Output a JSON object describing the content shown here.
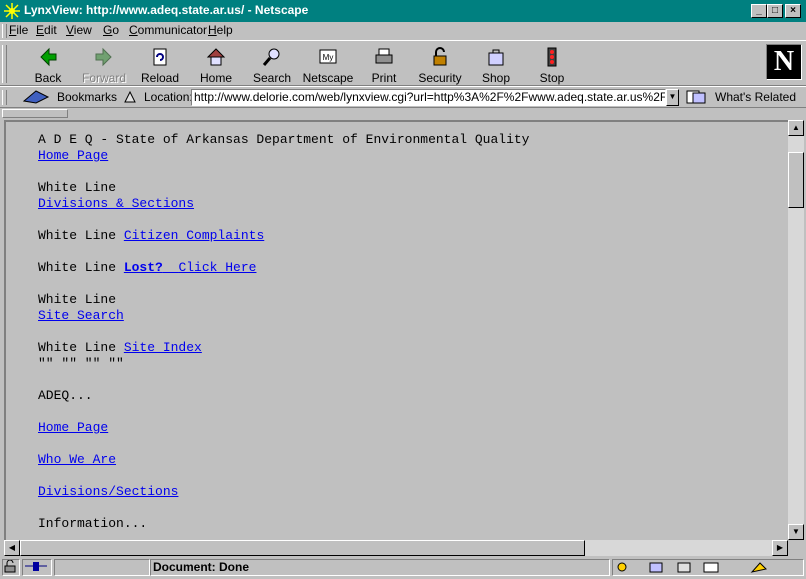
{
  "window": {
    "title": "LynxView: http://www.adeq.state.ar.us/ - Netscape"
  },
  "menu": [
    {
      "label": "File",
      "key": "F",
      "rest": "ile"
    },
    {
      "label": "Edit",
      "key": "E",
      "rest": "dit"
    },
    {
      "label": "View",
      "key": "V",
      "rest": "iew"
    },
    {
      "label": "Go",
      "key": "G",
      "rest": "o"
    },
    {
      "label": "Communicator",
      "key": "C",
      "rest": "ommunicator"
    },
    {
      "label": "Help",
      "key": "H",
      "rest": "elp"
    }
  ],
  "toolbar": {
    "back": "Back",
    "forward": "Forward",
    "reload": "Reload",
    "home": "Home",
    "search": "Search",
    "netscape": "Netscape",
    "print": "Print",
    "security": "Security",
    "shop": "Shop",
    "stop": "Stop"
  },
  "location": {
    "bookmarks_label": "Bookmarks",
    "location_label": "Location:",
    "url": "http://www.delorie.com/web/lynxview.cgi?url=http%3A%2F%2Fwww.adeq.state.ar.us%2F",
    "whats_related": "What's Related"
  },
  "page": {
    "heading": "A D E Q - State of Arkansas Department of Environmental Quality",
    "home_page_1": "Home Page",
    "white_line": "White Line",
    "divisions_sections": "Divisions & Sections",
    "citizen_complaints": "Citizen Complaints",
    "lost": "Lost?",
    "click_here": "Click Here",
    "site_search": "Site Search",
    "site_index": "Site Index",
    "quotes": "\"\" \"\" \"\" \"\"",
    "adeq": "ADEQ...",
    "home_page_2": "Home Page",
    "who_we_are": "Who We Are",
    "divisions_slash": "Divisions/Sections",
    "information": "Information..."
  },
  "status": {
    "text": "Document: Done"
  },
  "colors": {
    "titlebar": "#008080",
    "chrome": "#c0c0c0",
    "link": "#0000ee"
  }
}
